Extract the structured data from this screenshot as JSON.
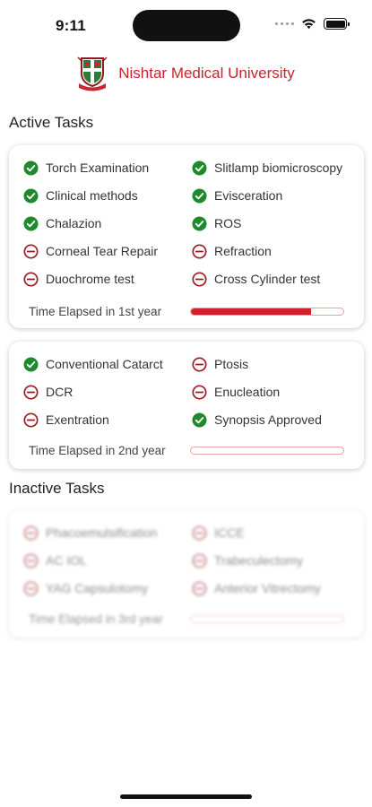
{
  "status": {
    "time": "9:11"
  },
  "app": {
    "name": "Nishtar Medical University"
  },
  "colors": {
    "brand": "#c6262e",
    "check": "#1e8a2c",
    "minus": "#9b1b21",
    "progress": "#d21f2b"
  },
  "sections": {
    "active_title": "Active Tasks",
    "inactive_title": "Inactive Tasks"
  },
  "cards": [
    {
      "tasks": [
        {
          "label": "Torch Examination",
          "status": "done"
        },
        {
          "label": "Slitlamp biomicroscopy",
          "status": "done"
        },
        {
          "label": "Clinical methods",
          "status": "done"
        },
        {
          "label": "Evisceration",
          "status": "done"
        },
        {
          "label": "Chalazion",
          "status": "done"
        },
        {
          "label": "ROS",
          "status": "done"
        },
        {
          "label": "Corneal Tear Repair",
          "status": "pending"
        },
        {
          "label": "Refraction",
          "status": "pending"
        },
        {
          "label": "Duochrome test",
          "status": "pending"
        },
        {
          "label": "Cross Cylinder test",
          "status": "pending"
        }
      ],
      "progress_label": "Time Elapsed in 1st year",
      "progress": 0.79
    },
    {
      "tasks": [
        {
          "label": "Conventional Catarct",
          "status": "done"
        },
        {
          "label": "Ptosis",
          "status": "pending"
        },
        {
          "label": "DCR",
          "status": "pending"
        },
        {
          "label": "Enucleation",
          "status": "pending"
        },
        {
          "label": "Exentration",
          "status": "pending"
        },
        {
          "label": "Synopsis Approved",
          "status": "done"
        }
      ],
      "progress_label": "Time Elapsed in 2nd year",
      "progress": 0
    },
    {
      "tasks": [
        {
          "label": "Phacoemulsification",
          "status": "pending"
        },
        {
          "label": "ICCE",
          "status": "pending"
        },
        {
          "label": "AC IOL",
          "status": "pending"
        },
        {
          "label": "Trabeculectomy",
          "status": "pending"
        },
        {
          "label": "YAG Capsulotomy",
          "status": "pending"
        },
        {
          "label": "Anterior Vitrectomy",
          "status": "pending"
        }
      ],
      "progress_label": "Time Elapsed in 3rd year",
      "progress": 0
    }
  ]
}
